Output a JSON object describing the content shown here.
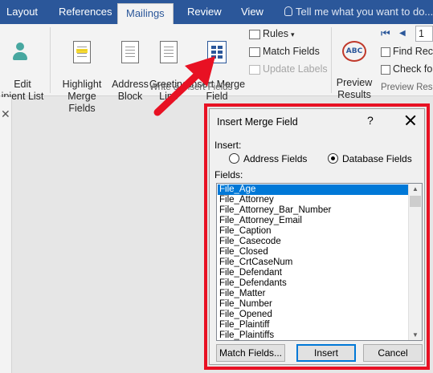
{
  "tabs": [
    "Layout",
    "References",
    "Mailings",
    "Review",
    "View"
  ],
  "active_tab": "Mailings",
  "tell_me": "Tell me what you want to do...",
  "ribbon": {
    "recipient": "Edit\nipient List",
    "highlight": "Highlight\nMerge Fields",
    "address_block": "Address\nBlock",
    "greeting_line": "Greeting\nLine",
    "insert_merge_field": "Insert Merge\nField",
    "rules": "Rules",
    "match_fields": "Match Fields",
    "update_labels": "Update Labels",
    "group_label_write": "Write & Insert Fields",
    "preview_results": "Preview\nResults",
    "record_number": "1",
    "find_recipient": "Find Rec",
    "check_for_errors": "Check for",
    "group_label_preview": "Preview Resu"
  },
  "dialog": {
    "title": "Insert Merge Field",
    "help": "?",
    "insert_label": "Insert:",
    "address_fields": "Address Fields",
    "database_fields": "Database Fields",
    "selected_radio": "database_fields",
    "fields_label": "Fields:",
    "fields": [
      "File_Age",
      "File_Attorney",
      "File_Attorney_Bar_Number",
      "File_Attorney_Email",
      "File_Caption",
      "File_Casecode",
      "File_Closed",
      "File_CrtCaseNum",
      "File_Defendant",
      "File_Defendants",
      "File_Matter",
      "File_Number",
      "File_Opened",
      "File_Plaintiff",
      "File_Plaintiffs"
    ],
    "selected_field": "File_Age",
    "match_fields_button": "Match Fields...",
    "insert_button": "Insert",
    "cancel_button": "Cancel"
  },
  "colors": {
    "accent": "#2b579a",
    "highlight_frame": "#e81123",
    "arrow": "#e81123",
    "selection": "#0078d7"
  }
}
